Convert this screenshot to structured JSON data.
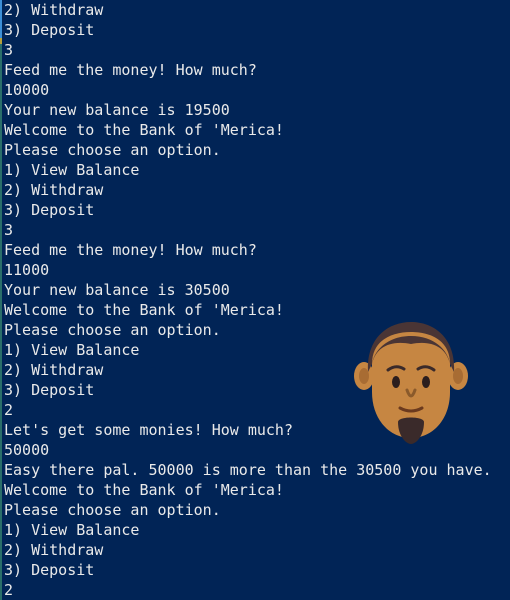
{
  "terminal": {
    "background": "#012456",
    "text_color": "#eaeaea",
    "lines": [
      "2) Withdraw",
      "3) Deposit",
      "3",
      "Feed me the money! How much?",
      "10000",
      "Your new balance is 19500",
      "Welcome to the Bank of 'Merica!",
      "Please choose an option.",
      "1) View Balance",
      "2) Withdraw",
      "3) Deposit",
      "3",
      "Feed me the money! How much?",
      "11000",
      "Your new balance is 30500",
      "Welcome to the Bank of 'Merica!",
      "Please choose an option.",
      "1) View Balance",
      "2) Withdraw",
      "3) Deposit",
      "2",
      "Let's get some monies! How much?",
      "50000",
      "Easy there pal. 50000 is more than the 30500 you have.",
      "Welcome to the Bank of 'Merica!",
      "Please choose an option.",
      "1) View Balance",
      "2) Withdraw",
      "3) Deposit",
      "2"
    ]
  },
  "avatar": {
    "icon": "man-face-emoji-icon",
    "skin_color": "#c68642",
    "hair_color": "#4a3535"
  }
}
